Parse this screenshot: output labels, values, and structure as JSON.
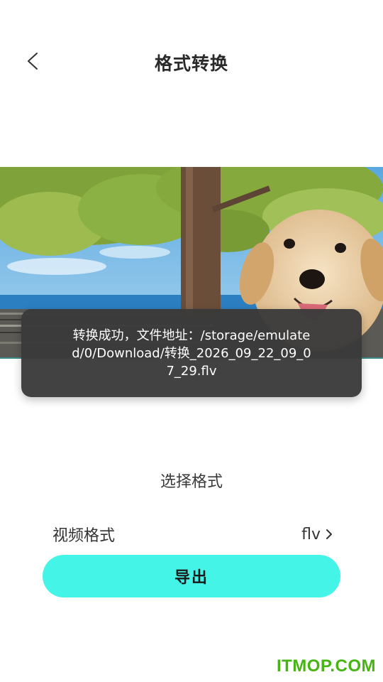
{
  "header": {
    "title": "格式转换",
    "back_icon": "chevron-left-icon"
  },
  "preview": {
    "content": "video-thumbnail-puppy"
  },
  "toast": {
    "message": "转换成功，文件地址：/storage/emulated/0/Download/转换_2026_09_22_09_07_29.flv"
  },
  "format_section": {
    "label": "选择格式",
    "row_label": "视频格式",
    "row_value": "flv",
    "row_icon": "chevron-right-icon"
  },
  "actions": {
    "export_label": "导出"
  },
  "watermark": {
    "text": "ITMOP.COM"
  },
  "colors": {
    "accent": "#44f4e6",
    "toast_bg": "#3a3a3a",
    "watermark": "#47b414"
  }
}
